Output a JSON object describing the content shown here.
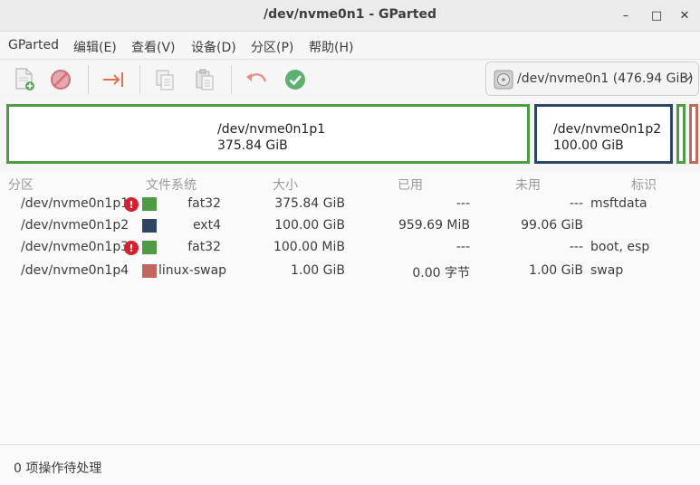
{
  "window": {
    "title": "/dev/nvme0n1 - GParted",
    "minimize_glyph": "–",
    "maximize_glyph": "□",
    "close_glyph": "✕"
  },
  "menu": {
    "items": [
      {
        "label": "GParted"
      },
      {
        "label": "编辑(E)"
      },
      {
        "label": "查看(V)"
      },
      {
        "label": "设备(D)"
      },
      {
        "label": "分区(P)"
      },
      {
        "label": "帮助(H)"
      }
    ]
  },
  "toolbar": {
    "icons": [
      "new-partition-icon",
      "delete-icon",
      "resize-move-icon",
      "copy-icon",
      "paste-icon",
      "undo-icon",
      "apply-icon"
    ]
  },
  "device": {
    "label": "/dev/nvme0n1 (476.94 GiB)"
  },
  "partition_map": [
    {
      "name": "/dev/nvme0n1p1",
      "size": "375.84 GiB",
      "color": "#4e9a45"
    },
    {
      "name": "/dev/nvme0n1p2",
      "size": "100.00 GiB",
      "color": "#2f4660"
    },
    {
      "name": "",
      "size": "",
      "color": "#4e9a45"
    },
    {
      "name": "",
      "size": "",
      "color": "#c0685e"
    }
  ],
  "table": {
    "headers": {
      "partition": "分区",
      "filesystem": "文件系统",
      "size": "大小",
      "used": "已用",
      "unused": "未用",
      "flags": "标识"
    },
    "rows": [
      {
        "partition": "/dev/nvme0n1p1",
        "warning": true,
        "fs_color": "#4e9a45",
        "filesystem": "fat32",
        "size": "375.84 GiB",
        "used": "---",
        "unused": "---",
        "flags": "msftdata"
      },
      {
        "partition": "/dev/nvme0n1p2",
        "warning": false,
        "fs_color": "#2f4660",
        "filesystem": "ext4",
        "size": "100.00 GiB",
        "used": "959.69 MiB",
        "unused": "99.06 GiB",
        "flags": ""
      },
      {
        "partition": "/dev/nvme0n1p3",
        "warning": true,
        "fs_color": "#4e9a45",
        "filesystem": "fat32",
        "size": "100.00 MiB",
        "used": "---",
        "unused": "---",
        "flags": "boot, esp"
      },
      {
        "partition": "/dev/nvme0n1p4",
        "warning": false,
        "fs_color": "#c0685e",
        "filesystem": "linux-swap",
        "size": "1.00 GiB",
        "used": "0.00 字节",
        "unused": "1.00 GiB",
        "flags": "swap"
      }
    ]
  },
  "status": {
    "text": "0 项操作待处理"
  }
}
